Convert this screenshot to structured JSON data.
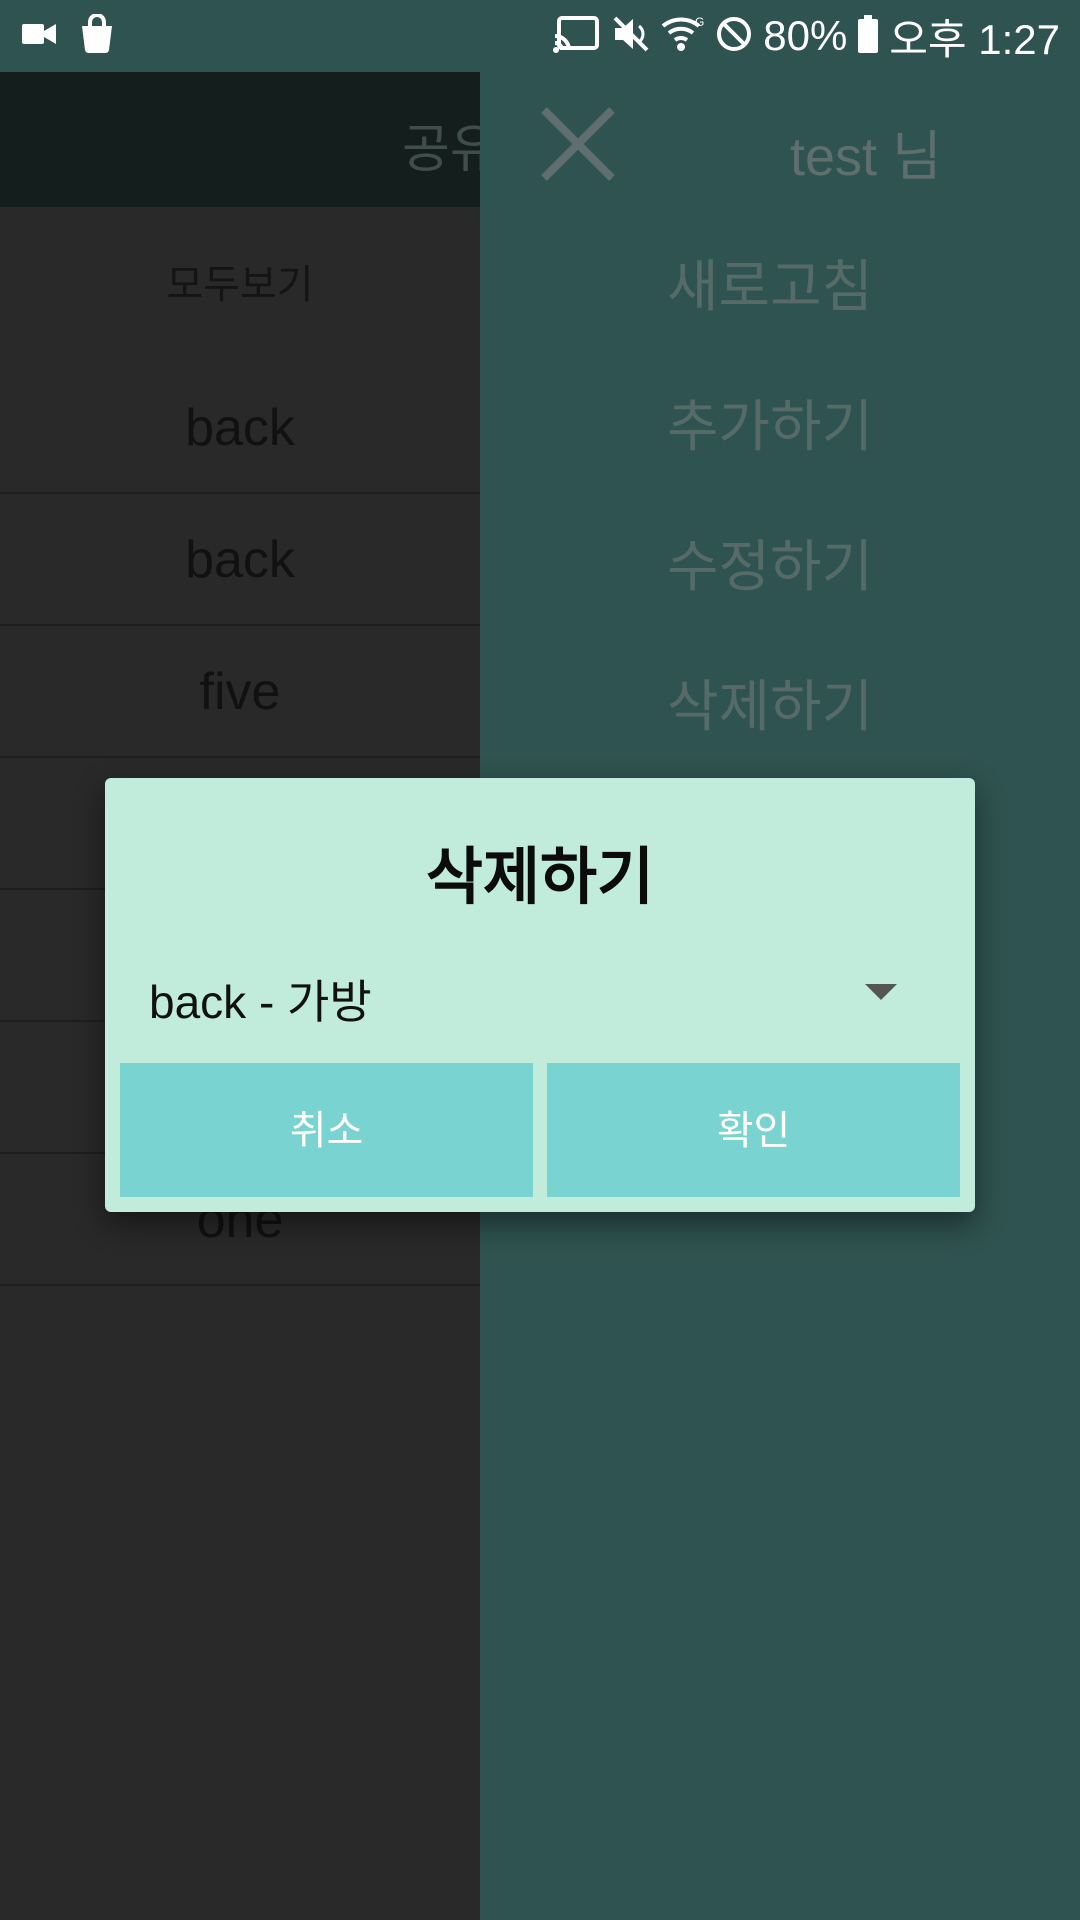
{
  "status_bar": {
    "left_icons": [
      "video-camera-icon",
      "shopping-bag-icon"
    ],
    "right_icons": [
      "cast-icon",
      "mute-icon",
      "wifi-icon",
      "do-not-disturb-icon",
      "battery-icon"
    ],
    "battery": "80%",
    "time": "오후 1:27"
  },
  "main": {
    "header_title": "공유",
    "categories": {
      "all": "모두보기"
    },
    "list_items": [
      "back",
      "back",
      "five",
      "",
      "",
      "",
      "one"
    ]
  },
  "drawer": {
    "close_icon": "close-icon",
    "user_label": "test 님",
    "menu": [
      "새로고침",
      "추가하기",
      "수정하기",
      "삭제하기"
    ]
  },
  "dialog": {
    "title": "삭제하기",
    "select_value": "back - 가방",
    "cancel_label": "취소",
    "confirm_label": "확인"
  },
  "colors": {
    "status_bar": "#2f5350",
    "drawer_bg": "#2f5350",
    "dialog_bg": "#c1ecdb",
    "button_bg": "#79d3d0"
  }
}
